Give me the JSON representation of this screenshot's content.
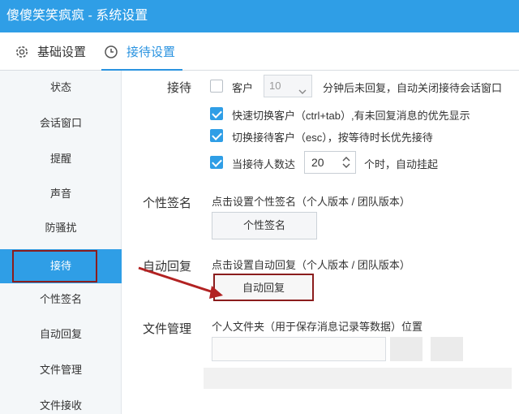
{
  "window": {
    "title": "傻傻笑笑疯疯 - 系统设置"
  },
  "tabs": [
    {
      "label": "基础设置",
      "icon": "gear-icon"
    },
    {
      "label": "接待设置",
      "icon": "clock-icon"
    }
  ],
  "sidebar": {
    "items": [
      {
        "label": "状态"
      },
      {
        "label": "会话窗口"
      },
      {
        "label": "提醒"
      },
      {
        "label": "声音"
      },
      {
        "label": "防骚扰"
      },
      {
        "label": "接待"
      },
      {
        "label": "个性签名"
      },
      {
        "label": "自动回复"
      },
      {
        "label": "文件管理"
      },
      {
        "label": "文件接收"
      }
    ],
    "active": "接待"
  },
  "reception": {
    "label": "接待",
    "customer_label": "客户",
    "customer_minutes": "10",
    "auto_close_text": "分钟后未回复，自动关闭接待会话窗口",
    "fast_switch_text": "快速切换客户（ctrl+tab）,有未回复消息的优先显示",
    "switch_text": "切换接待客户（esc），按等待时长优先接待",
    "limit_prefix": "当接待人数达",
    "limit_value": "20",
    "limit_suffix": "个时，自动挂起"
  },
  "signature": {
    "label": "个性签名",
    "hint": "点击设置个性签名（个人版本 / 团队版本）",
    "button": "个性签名"
  },
  "auto_reply": {
    "label": "自动回复",
    "hint": "点击设置自动回复（个人版本 / 团队版本）",
    "button": "自动回复"
  },
  "file_mgmt": {
    "label": "文件管理",
    "hint": "个人文件夹（用于保存消息记录等数据）位置"
  },
  "colors": {
    "accent": "#2f9ee6",
    "highlight": "#8b1d1d"
  }
}
